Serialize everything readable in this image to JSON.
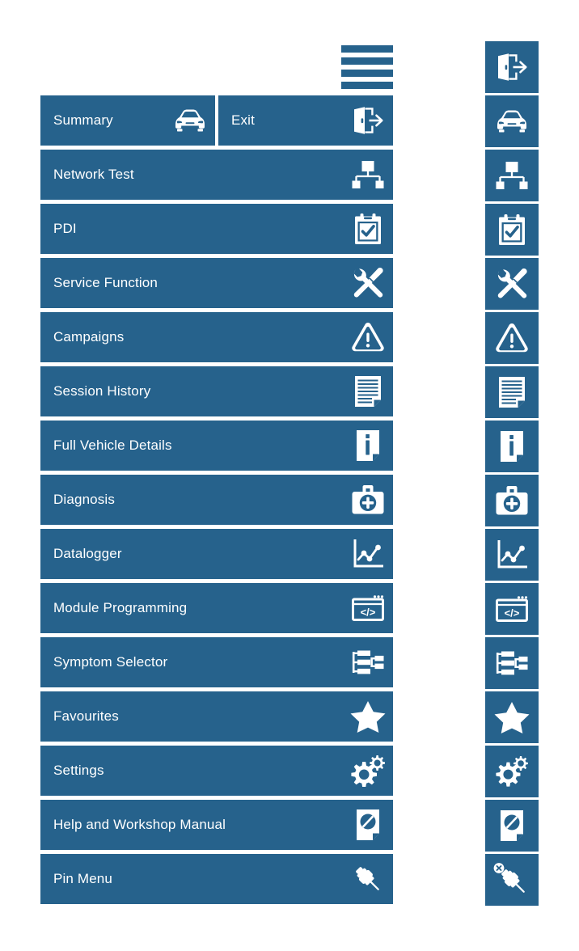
{
  "theme": {
    "panel_color": "#26628c",
    "icon_color": "#ffffff",
    "page_background": "#ffffff"
  },
  "hamburger": {
    "name": "menu-toggle",
    "bar_count": 4
  },
  "menu": {
    "top_row": [
      {
        "label": "Summary",
        "icon": "car-icon"
      },
      {
        "label": "Exit",
        "icon": "exit-door-icon"
      }
    ],
    "items": [
      {
        "label": "Network Test",
        "icon": "network-topology-icon"
      },
      {
        "label": "PDI",
        "icon": "clipboard-check-icon"
      },
      {
        "label": "Service Function",
        "icon": "wrench-screwdriver-icon"
      },
      {
        "label": "Campaigns",
        "icon": "warning-triangle-icon"
      },
      {
        "label": "Session History",
        "icon": "document-lines-icon"
      },
      {
        "label": "Full Vehicle Details",
        "icon": "document-info-icon"
      },
      {
        "label": "Diagnosis",
        "icon": "medical-bag-icon"
      },
      {
        "label": "Datalogger",
        "icon": "line-chart-icon"
      },
      {
        "label": "Module Programming",
        "icon": "code-window-icon"
      },
      {
        "label": "Symptom Selector",
        "icon": "tree-list-icon"
      },
      {
        "label": "Favourites",
        "icon": "star-icon"
      },
      {
        "label": "Settings",
        "icon": "gears-icon"
      },
      {
        "label": "Help and Workshop Manual",
        "icon": "help-document-icon"
      },
      {
        "label": "Pin Menu",
        "icon": "pushpin-icon"
      }
    ]
  },
  "icon_rail": {
    "items": [
      {
        "icon": "exit-door-icon",
        "tooltip": "Exit"
      },
      {
        "icon": "car-icon",
        "tooltip": "Summary"
      },
      {
        "icon": "network-topology-icon",
        "tooltip": "Network Test"
      },
      {
        "icon": "clipboard-check-icon",
        "tooltip": "PDI"
      },
      {
        "icon": "wrench-screwdriver-icon",
        "tooltip": "Service Function"
      },
      {
        "icon": "warning-triangle-icon",
        "tooltip": "Campaigns"
      },
      {
        "icon": "document-lines-icon",
        "tooltip": "Session History"
      },
      {
        "icon": "document-info-icon",
        "tooltip": "Full Vehicle Details"
      },
      {
        "icon": "medical-bag-icon",
        "tooltip": "Diagnosis"
      },
      {
        "icon": "line-chart-icon",
        "tooltip": "Datalogger"
      },
      {
        "icon": "code-window-icon",
        "tooltip": "Module Programming"
      },
      {
        "icon": "tree-list-icon",
        "tooltip": "Symptom Selector"
      },
      {
        "icon": "star-icon",
        "tooltip": "Favourites"
      },
      {
        "icon": "gears-icon",
        "tooltip": "Settings"
      },
      {
        "icon": "help-document-icon",
        "tooltip": "Help and Workshop Manual"
      },
      {
        "icon": "pushpin-unpin-icon",
        "tooltip": "Unpin Menu"
      }
    ]
  }
}
